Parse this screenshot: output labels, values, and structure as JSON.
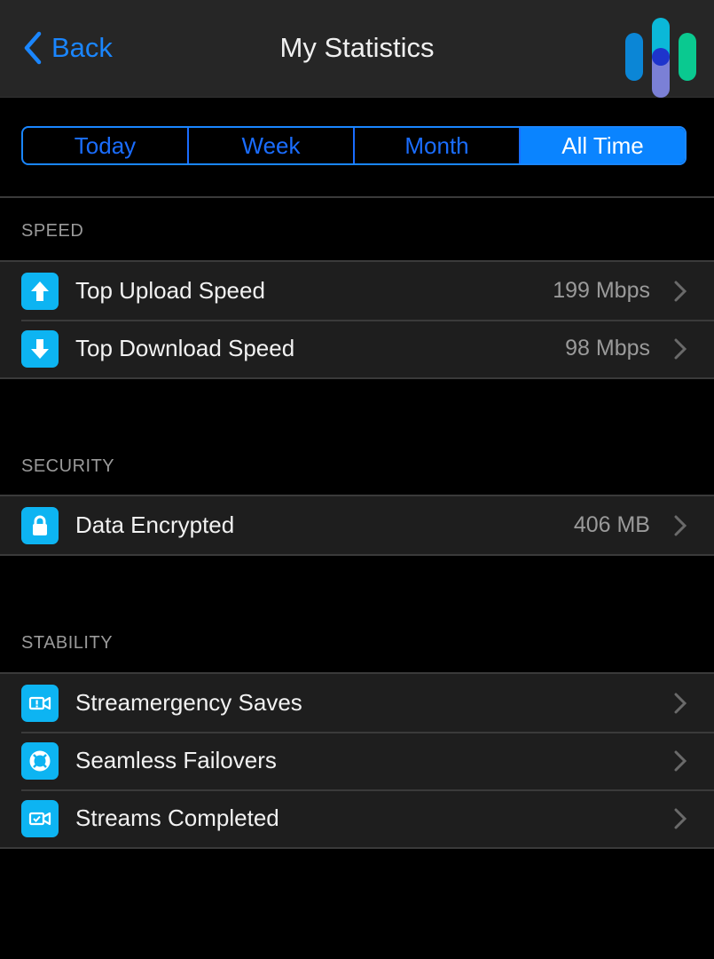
{
  "header": {
    "back_label": "Back",
    "title": "My Statistics"
  },
  "tabs": [
    {
      "label": "Today",
      "selected": false
    },
    {
      "label": "Week",
      "selected": false
    },
    {
      "label": "Month",
      "selected": false
    },
    {
      "label": "All Time",
      "selected": true
    }
  ],
  "sections": {
    "speed": {
      "label": "SPEED",
      "items": [
        {
          "icon": "arrow-up-icon",
          "label": "Top Upload Speed",
          "value": "199 Mbps"
        },
        {
          "icon": "arrow-down-icon",
          "label": "Top Download Speed",
          "value": "98 Mbps"
        }
      ]
    },
    "security": {
      "label": "SECURITY",
      "items": [
        {
          "icon": "lock-icon",
          "label": "Data Encrypted",
          "value": "406 MB"
        }
      ]
    },
    "stability": {
      "label": "STABILITY",
      "items": [
        {
          "icon": "video-alert-icon",
          "label": "Streamergency Saves",
          "value": ""
        },
        {
          "icon": "lifebuoy-icon",
          "label": "Seamless Failovers",
          "value": ""
        },
        {
          "icon": "video-check-icon",
          "label": "Streams Completed",
          "value": ""
        }
      ]
    }
  },
  "colors": {
    "accent": "#0a84ff",
    "icon_bg": "#0db4f2",
    "navbar_bg": "#262626",
    "row_bg": "#1e1e1e"
  }
}
